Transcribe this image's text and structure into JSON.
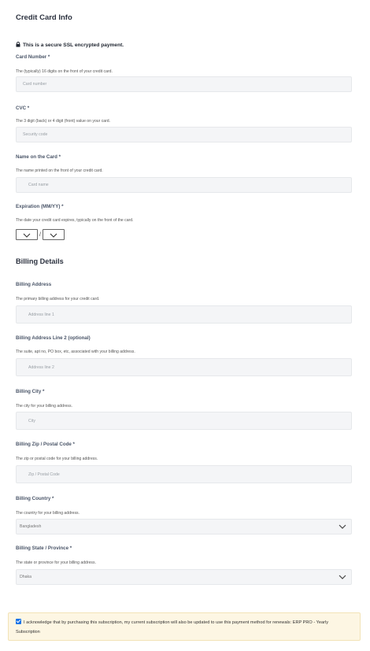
{
  "credit_card": {
    "title": "Credit Card Info",
    "secure_note": "This is a secure SSL encrypted payment.",
    "card_number": {
      "label": "Card Number *",
      "description": "The (typically) 16 digits on the front of your credit card.",
      "placeholder": "Card number"
    },
    "cvc": {
      "label": "CVC *",
      "description": "The 3 digit (back) or 4 digit (front) value on your card.",
      "placeholder": "Security code"
    },
    "name": {
      "label": "Name on the Card *",
      "description": "The name printed on the front of your credit card.",
      "placeholder": "Card name"
    },
    "expiration": {
      "label": "Expiration (MM/YY) *",
      "description": "The date your credit card expires, typically on the front of the card.",
      "separator": "/"
    }
  },
  "billing": {
    "title": "Billing Details",
    "address": {
      "label": "Billing Address",
      "description": "The primary billing address for your credit card.",
      "placeholder": "Address line 1"
    },
    "address2": {
      "label": "Billing Address Line 2 (optional)",
      "description": "The suite, apt no, PO box, etc, associated with your billing address.",
      "placeholder": "Address line 2"
    },
    "city": {
      "label": "Billing City *",
      "description": "The city for your billing address.",
      "placeholder": "City"
    },
    "zip": {
      "label": "Billing Zip / Postal Code *",
      "description": "The zip or postal code for your billing address.",
      "placeholder": "Zip / Postal Code"
    },
    "country": {
      "label": "Billing Country *",
      "description": "The country for your billing address.",
      "value": "Bangladesh"
    },
    "state": {
      "label": "Billing State / Province *",
      "description": "The state or province for your billing address.",
      "value": "Dhaka"
    }
  },
  "acknowledgement": {
    "text": "I acknowledge that by purchasing this subscription, my current subscription will also be updated to use this payment method for renewals: ERP PRO - Yearly Subscription",
    "checked": true
  },
  "colors": {
    "accent": "#1a73e8",
    "notice_bg": "#fdf6e3",
    "input_bg": "#f4f5f7"
  }
}
